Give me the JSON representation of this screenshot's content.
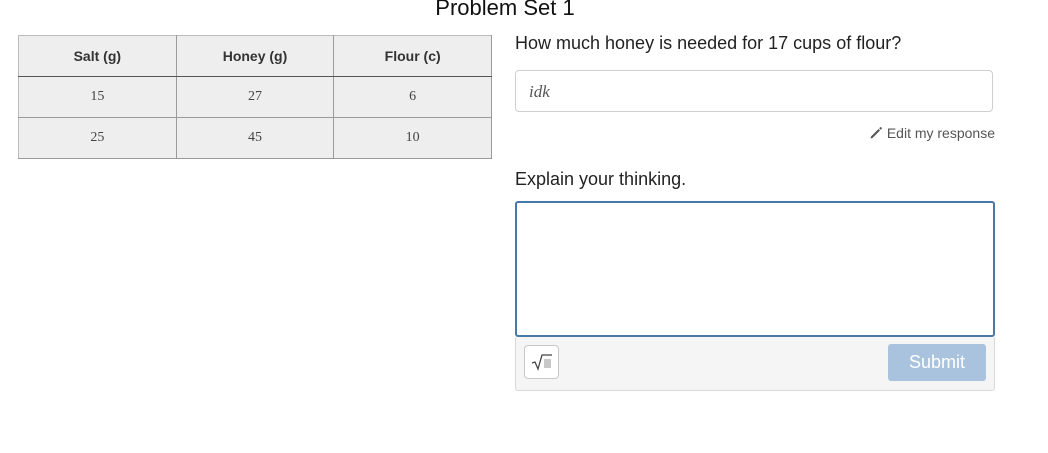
{
  "page": {
    "title": "Problem Set 1"
  },
  "table": {
    "headers": [
      "Salt (g)",
      "Honey (g)",
      "Flour (c)"
    ],
    "rows": [
      [
        "15",
        "27",
        "6"
      ],
      [
        "25",
        "45",
        "10"
      ]
    ]
  },
  "question": {
    "prompt": "How much honey is needed for 17 cups of flour?",
    "answer_value": "idk",
    "edit_label": "Edit my response",
    "edit_icon": "pencil-icon"
  },
  "explain": {
    "prompt": "Explain your thinking.",
    "value": "",
    "math_icon": "square-root-icon",
    "submit_label": "Submit"
  },
  "colors": {
    "focus_border": "#4a78a8",
    "submit_disabled": "#a9c3de"
  }
}
